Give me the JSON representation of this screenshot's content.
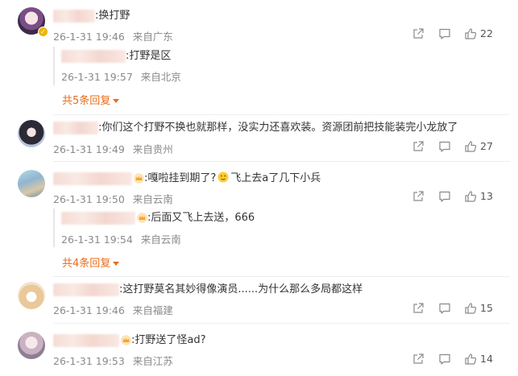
{
  "comments": [
    {
      "text": ":换打野",
      "time": "26-1-31 19:46",
      "location": "来自广东",
      "likes": "22",
      "reply": {
        "text": ":打野是区",
        "time": "26-1-31 19:57",
        "location": "来自北京"
      },
      "more": "共5条回复"
    },
    {
      "text": ":你们这个打野不换也就那样，没实力还喜欢装。资源团前把技能装完小龙放了",
      "time": "26-1-31 19:49",
      "location": "来自贵州",
      "likes": "27"
    },
    {
      "text": ":嘎啦挂到期了?",
      "text2": "飞上去a了几下小兵",
      "time": "26-1-31 19:50",
      "location": "来自云南",
      "likes": "13",
      "reply": {
        "text": ":后面又飞上去送，666",
        "time": "26-1-31 19:54",
        "location": "来自云南"
      },
      "more": "共4条回复"
    },
    {
      "text": ":这打野莫名其妙得像演员......为什么那么多局都这样",
      "time": "26-1-31 19:46",
      "location": "来自福建",
      "likes": "15"
    },
    {
      "text": ":打野送了怪ad?",
      "time": "26-1-31 19:53",
      "location": "来自江苏",
      "likes": "14"
    }
  ],
  "colors": {
    "accent": "#e86d1c",
    "meta": "#8a8a8a",
    "crown": "#f5a623"
  },
  "icons": [
    "share-icon",
    "comment-icon",
    "like-icon",
    "crown-icon",
    "verified-icon",
    "emoji-icon"
  ]
}
